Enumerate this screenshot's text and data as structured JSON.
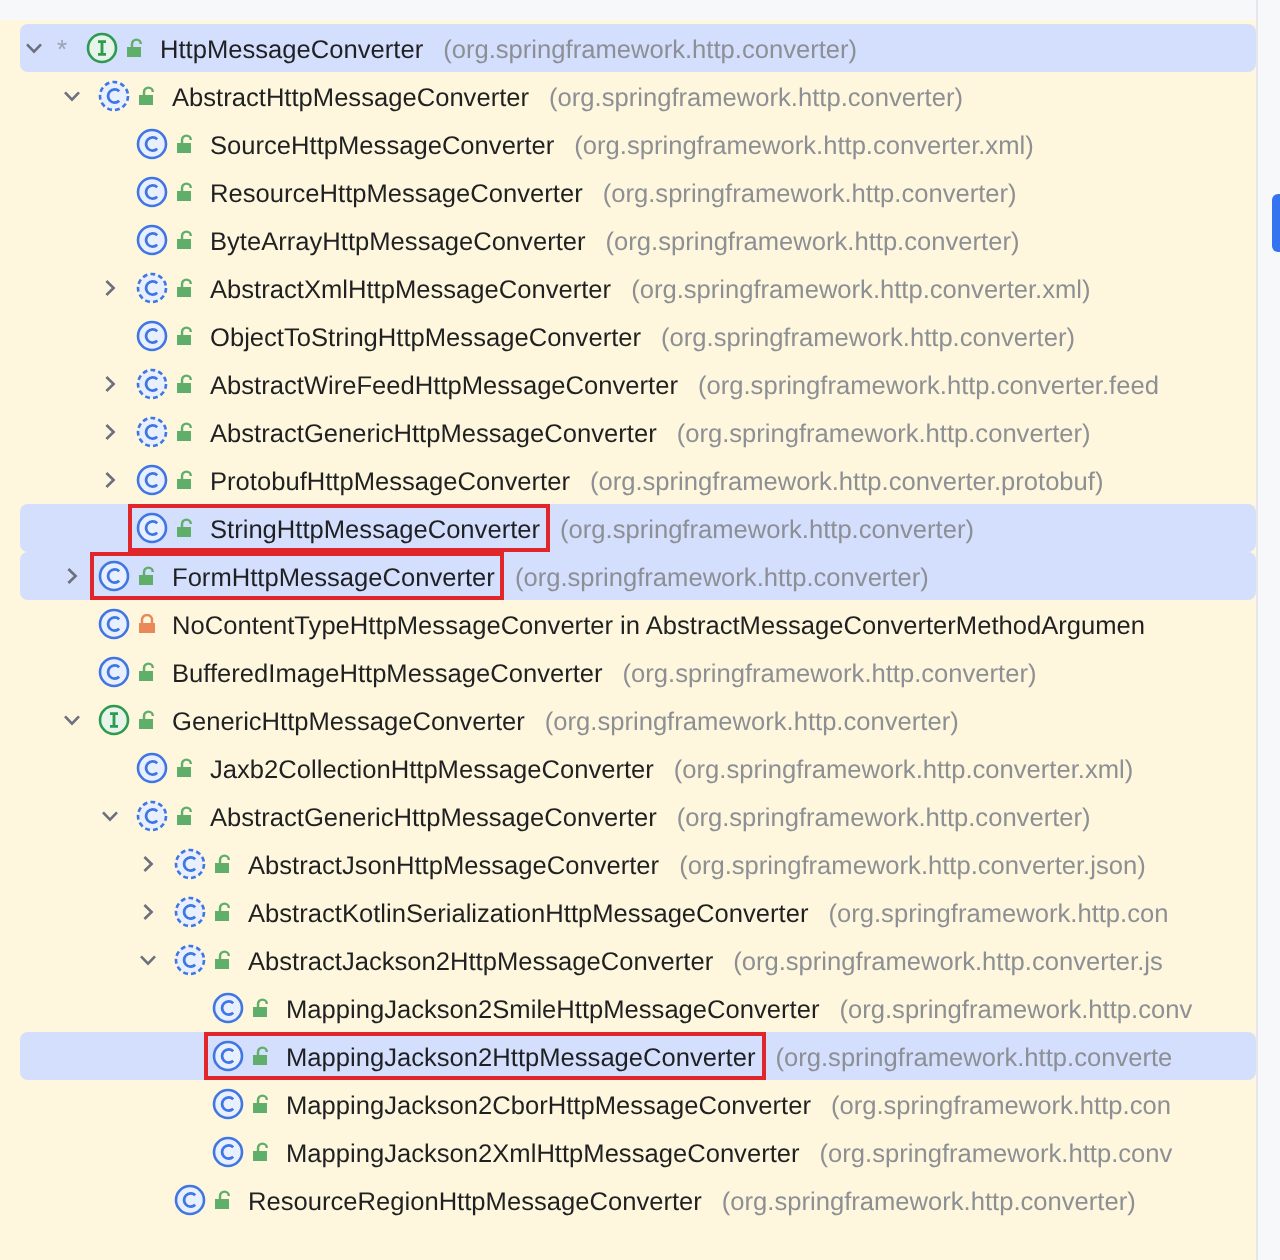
{
  "tree": [
    {
      "kind": "interface",
      "locked": false,
      "marker": "*",
      "name": "HttpMessageConverter",
      "package": "(org.springframework.http.converter)",
      "selected": true,
      "marked": false,
      "expanded": true,
      "children": [
        {
          "kind": "abstract_class",
          "locked": false,
          "name": "AbstractHttpMessageConverter",
          "package": "(org.springframework.http.converter)",
          "selected": false,
          "marked": false,
          "expanded": true,
          "children": [
            {
              "kind": "class",
              "locked": false,
              "name": "SourceHttpMessageConverter",
              "package": "(org.springframework.http.converter.xml)",
              "selected": false,
              "marked": false
            },
            {
              "kind": "class",
              "locked": false,
              "name": "ResourceHttpMessageConverter",
              "package": "(org.springframework.http.converter)",
              "selected": false,
              "marked": false
            },
            {
              "kind": "class",
              "locked": false,
              "name": "ByteArrayHttpMessageConverter",
              "package": "(org.springframework.http.converter)",
              "selected": false,
              "marked": false
            },
            {
              "kind": "abstract_class",
              "locked": false,
              "name": "AbstractXmlHttpMessageConverter",
              "package": "(org.springframework.http.converter.xml)",
              "selected": false,
              "marked": false,
              "expanded": false
            },
            {
              "kind": "class",
              "locked": false,
              "name": "ObjectToStringHttpMessageConverter",
              "package": "(org.springframework.http.converter)",
              "selected": false,
              "marked": false
            },
            {
              "kind": "abstract_class",
              "locked": false,
              "name": "AbstractWireFeedHttpMessageConverter",
              "package": "(org.springframework.http.converter.feed",
              "selected": false,
              "marked": false,
              "expanded": false
            },
            {
              "kind": "abstract_class",
              "locked": false,
              "name": "AbstractGenericHttpMessageConverter",
              "package": "(org.springframework.http.converter)",
              "selected": false,
              "marked": false,
              "expanded": false
            },
            {
              "kind": "class",
              "locked": false,
              "name": "ProtobufHttpMessageConverter",
              "package": "(org.springframework.http.converter.protobuf)",
              "selected": false,
              "marked": false,
              "expanded": false
            },
            {
              "kind": "class",
              "locked": false,
              "name": "StringHttpMessageConverter",
              "package": "(org.springframework.http.converter)",
              "selected": true,
              "marked": true
            }
          ]
        },
        {
          "kind": "class",
          "locked": false,
          "name": "FormHttpMessageConverter",
          "package": "(org.springframework.http.converter)",
          "selected": true,
          "marked": true,
          "expanded": false
        },
        {
          "kind": "class",
          "locked": true,
          "name": "NoContentTypeHttpMessageConverter in AbstractMessageConverterMethodArgumen",
          "selected": false,
          "marked": false
        },
        {
          "kind": "class",
          "locked": false,
          "name": "BufferedImageHttpMessageConverter",
          "package": "(org.springframework.http.converter)",
          "selected": false,
          "marked": false
        },
        {
          "kind": "interface",
          "locked": false,
          "name": "GenericHttpMessageConverter",
          "package": "(org.springframework.http.converter)",
          "selected": false,
          "marked": false,
          "expanded": true,
          "children": [
            {
              "kind": "class",
              "locked": false,
              "name": "Jaxb2CollectionHttpMessageConverter",
              "package": "(org.springframework.http.converter.xml)",
              "selected": false,
              "marked": false
            },
            {
              "kind": "abstract_class",
              "locked": false,
              "name": "AbstractGenericHttpMessageConverter",
              "package": "(org.springframework.http.converter)",
              "selected": false,
              "marked": false,
              "expanded": true,
              "children": [
                {
                  "kind": "abstract_class",
                  "locked": false,
                  "name": "AbstractJsonHttpMessageConverter",
                  "package": "(org.springframework.http.converter.json)",
                  "selected": false,
                  "marked": false,
                  "expanded": false
                },
                {
                  "kind": "abstract_class",
                  "locked": false,
                  "name": "AbstractKotlinSerializationHttpMessageConverter",
                  "package": "(org.springframework.http.con",
                  "selected": false,
                  "marked": false,
                  "expanded": false
                },
                {
                  "kind": "abstract_class",
                  "locked": false,
                  "name": "AbstractJackson2HttpMessageConverter",
                  "package": "(org.springframework.http.converter.js",
                  "selected": false,
                  "marked": false,
                  "expanded": true,
                  "children": [
                    {
                      "kind": "class",
                      "locked": false,
                      "name": "MappingJackson2SmileHttpMessageConverter",
                      "package": "(org.springframework.http.conv",
                      "selected": false,
                      "marked": false
                    },
                    {
                      "kind": "class",
                      "locked": false,
                      "name": "MappingJackson2HttpMessageConverter",
                      "package": "(org.springframework.http.converte",
                      "selected": true,
                      "marked": true
                    },
                    {
                      "kind": "class",
                      "locked": false,
                      "name": "MappingJackson2CborHttpMessageConverter",
                      "package": "(org.springframework.http.con",
                      "selected": false,
                      "marked": false
                    },
                    {
                      "kind": "class",
                      "locked": false,
                      "name": "MappingJackson2XmlHttpMessageConverter",
                      "package": "(org.springframework.http.conv",
                      "selected": false,
                      "marked": false
                    }
                  ]
                },
                {
                  "kind": "class",
                  "locked": false,
                  "name": "ResourceRegionHttpMessageConverter",
                  "package": "(org.springframework.http.converter)",
                  "selected": false,
                  "marked": false
                }
              ]
            }
          ]
        }
      ]
    }
  ]
}
